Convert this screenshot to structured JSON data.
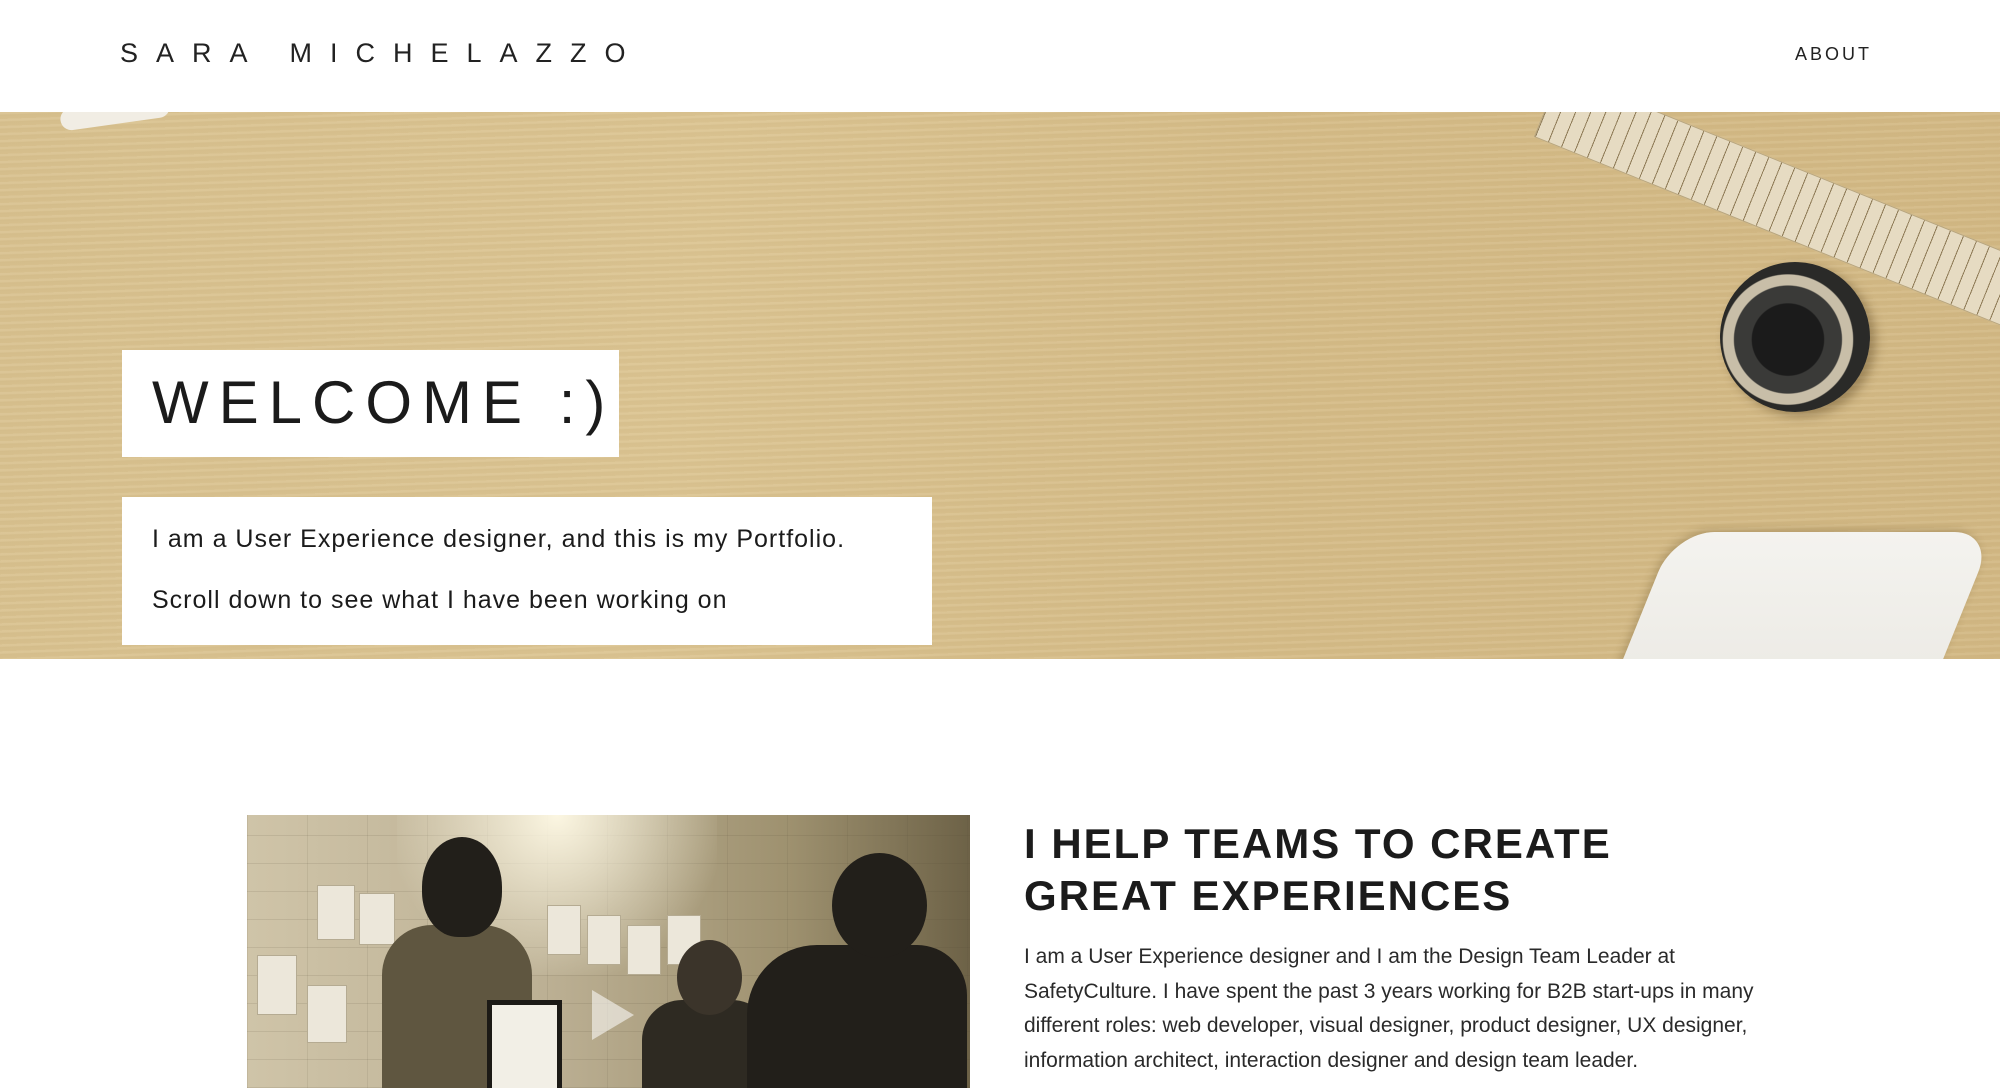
{
  "header": {
    "site_title": "SARA MICHELAZZO",
    "nav": {
      "about_label": "ABOUT"
    }
  },
  "hero": {
    "welcome": "WELCOME :)",
    "intro_line_1": "I am a User Experience designer, and this is my Portfolio.",
    "intro_line_2": "Scroll down to see what I have been working on"
  },
  "about_section": {
    "heading": "I HELP TEAMS TO CREATE GREAT EXPERIENCES",
    "body": "I am a User Experience designer and I am the Design Team Leader at SafetyCulture. I have spent the past 3 years working for B2B start-ups in many different roles: web developer, visual designer, product designer, UX designer, information architect, interaction designer and design team leader.",
    "video_play_icon": "play-icon"
  },
  "colors": {
    "hero_wood": "#dcc593",
    "text": "#1b1b1b",
    "panel": "#ffffff"
  }
}
